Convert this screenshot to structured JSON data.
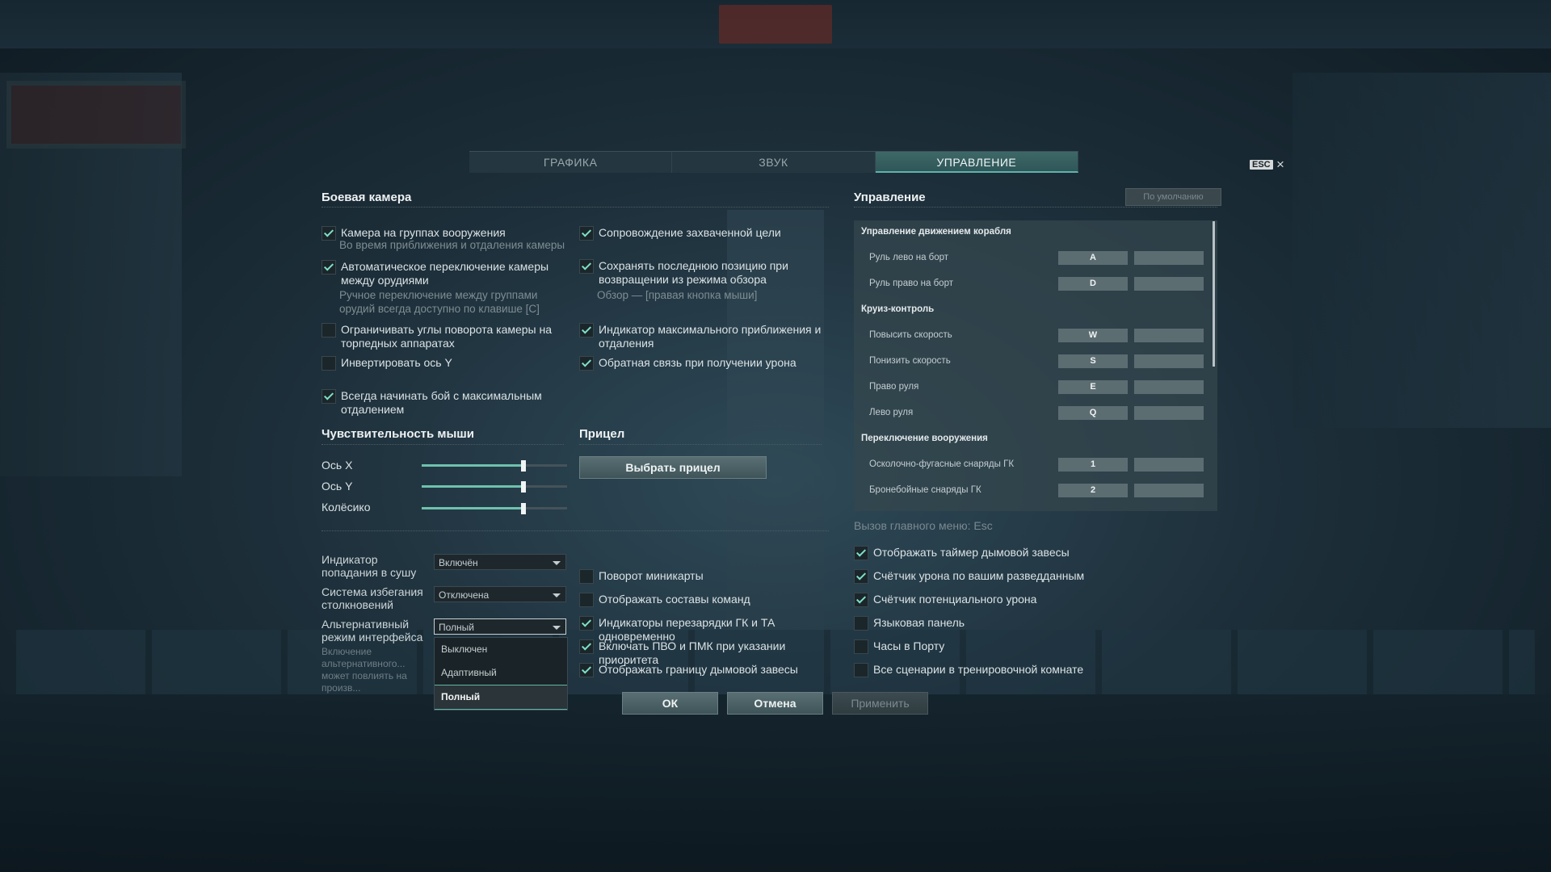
{
  "tabs": [
    {
      "label": "ГРАФИКА",
      "active": false
    },
    {
      "label": "ЗВУК",
      "active": false
    },
    {
      "label": "УПРАВЛЕНИЕ",
      "active": true
    }
  ],
  "close": {
    "esc_label": "ESC",
    "close_glyph": "×"
  },
  "camera": {
    "title": "Боевая камера",
    "left": [
      {
        "label": "Камера на группах вооружения",
        "hint": "Во время приближения и отдаления камеры",
        "checked": true
      },
      {
        "label": "Автоматическое переключение камеры между орудиями",
        "hint": "Ручное переключение между группами орудий всегда доступно по клавише [C]",
        "checked": true
      },
      {
        "label": "Ограничивать углы поворота камеры на торпедных аппаратах",
        "checked": false
      },
      {
        "label": "Инвертировать ось Y",
        "checked": false
      },
      {
        "label": "Всегда начинать бой с максимальным отдалением",
        "checked": true
      }
    ],
    "right": [
      {
        "label": "Сопровождение захваченной цели",
        "checked": true
      },
      {
        "label": "Сохранять последнюю позицию при возвращении из режима обзора",
        "hint": "Обзор — [правая кнопка мыши]",
        "checked": true
      },
      {
        "label": "Индикатор максимального приближения и отдаления",
        "checked": true
      },
      {
        "label": "Обратная связь при получении урона",
        "checked": true
      }
    ]
  },
  "mouse": {
    "title": "Чувствительность мыши",
    "sliders": [
      {
        "label": "Ось X",
        "value": 0.7
      },
      {
        "label": "Ось Y",
        "value": 0.7
      },
      {
        "label": "Колёсико",
        "value": 0.7
      }
    ]
  },
  "sight": {
    "title": "Прицел",
    "button": "Выбрать прицел"
  },
  "dropdowns": [
    {
      "label": "Индикатор попадания в сушу",
      "value": "Включён"
    },
    {
      "label": "Система избегания столкновений",
      "value": "Отключена"
    },
    {
      "label": "Альтернативный режим интерфейса",
      "value": "Полный",
      "hint": "Включение альтернативного... может повлиять на произв...",
      "options": [
        "Выключен",
        "Адаптивный",
        "Полный"
      ]
    }
  ],
  "middle_checks": [
    {
      "label": "Поворот миникарты",
      "checked": false
    },
    {
      "label": "Отображать составы команд",
      "checked": false
    },
    {
      "label": "Индикаторы перезарядки ГК и ТА одновременно",
      "checked": true
    },
    {
      "label": "Включать ПВО и ПМК при указании приоритета",
      "checked": true
    },
    {
      "label": "Отображать границу дымовой завесы",
      "checked": true
    }
  ],
  "right_checks": [
    {
      "label": "Отображать таймер дымовой завесы",
      "checked": true
    },
    {
      "label": "Счётчик урона по вашим разведданным",
      "checked": true
    },
    {
      "label": "Счётчик потенциального урона",
      "checked": true
    },
    {
      "label": "Языковая панель",
      "checked": false
    },
    {
      "label": "Часы в Порту",
      "checked": false
    },
    {
      "label": "Все сценарии в тренировочной комнате",
      "checked": false
    }
  ],
  "controls": {
    "title": "Управление",
    "default_button": "По умолчанию",
    "menu_hint": "Вызов главного меню: Esc",
    "sections": [
      {
        "title": "Управление движением корабля",
        "rows": [
          {
            "label": "Руль лево на борт",
            "key": "A"
          },
          {
            "label": "Руль право на борт",
            "key": "D"
          }
        ]
      },
      {
        "title": "Круиз-контроль",
        "rows": [
          {
            "label": "Повысить скорость",
            "key": "W"
          },
          {
            "label": "Понизить скорость",
            "key": "S"
          },
          {
            "label": "Право руля",
            "key": "E"
          },
          {
            "label": "Лево руля",
            "key": "Q"
          }
        ]
      },
      {
        "title": "Переключение вооружения",
        "rows": [
          {
            "label": "Осколочно-фугасные снаряды ГК",
            "key": "1"
          },
          {
            "label": "Бронебойные снаряды ГК",
            "key": "2"
          }
        ]
      }
    ]
  },
  "footer": {
    "ok": "ОК",
    "cancel": "Отмена",
    "apply": "Применить"
  },
  "colors": {
    "accent": "#5fb3a8",
    "check": "#7fe0c8",
    "active_tab": "#3e6868"
  }
}
